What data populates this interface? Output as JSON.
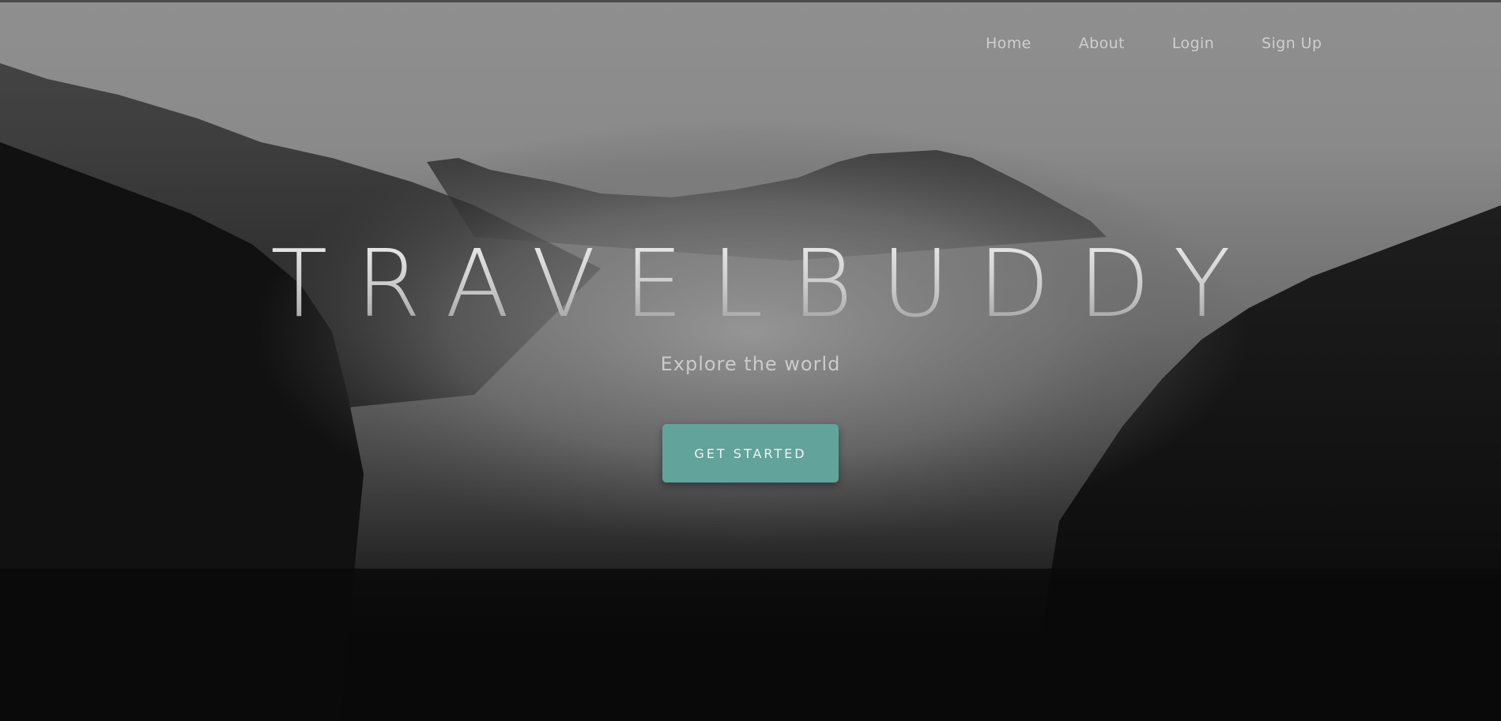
{
  "nav": {
    "items": [
      {
        "label": "Home"
      },
      {
        "label": "About"
      },
      {
        "label": "Login"
      },
      {
        "label": "Sign Up"
      }
    ]
  },
  "hero": {
    "title": "TRAVELBUDDY",
    "subtitle": "Explore the world",
    "cta_label": "GET STARTED"
  },
  "colors": {
    "accent": "#62a39c",
    "text_light": "#cfcfcf"
  }
}
